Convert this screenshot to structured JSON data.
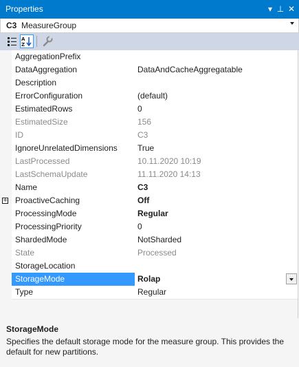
{
  "window": {
    "title": "Properties",
    "dropdown_glyph": "▾",
    "pin_glyph": "⊥",
    "close_glyph": "✕"
  },
  "object_selector": {
    "name": "C3",
    "type": "MeasureGroup"
  },
  "toolbar": {
    "categorized_icon": "categorized-icon",
    "alphabetical_icon": "alphabetical-icon",
    "property_pages_icon": "wrench-icon",
    "active": "alphabetical"
  },
  "properties": [
    {
      "name": "AggregationPrefix",
      "value": "",
      "readonly": false,
      "bold": false
    },
    {
      "name": "DataAggregation",
      "value": "DataAndCacheAggregatable",
      "readonly": false,
      "bold": false
    },
    {
      "name": "Description",
      "value": "",
      "readonly": false,
      "bold": false
    },
    {
      "name": "ErrorConfiguration",
      "value": "(default)",
      "readonly": false,
      "bold": false
    },
    {
      "name": "EstimatedRows",
      "value": "0",
      "readonly": false,
      "bold": false
    },
    {
      "name": "EstimatedSize",
      "value": "156",
      "readonly": true,
      "bold": false
    },
    {
      "name": "ID",
      "value": "C3",
      "readonly": true,
      "bold": false
    },
    {
      "name": "IgnoreUnrelatedDimensions",
      "value": "True",
      "readonly": false,
      "bold": false
    },
    {
      "name": "LastProcessed",
      "value": "10.11.2020 10:19",
      "readonly": true,
      "bold": false
    },
    {
      "name": "LastSchemaUpdate",
      "value": "11.11.2020 14:13",
      "readonly": true,
      "bold": false
    },
    {
      "name": "Name",
      "value": "C3",
      "readonly": false,
      "bold": true
    },
    {
      "name": "ProactiveCaching",
      "value": "Off",
      "readonly": false,
      "bold": true,
      "expandable": true
    },
    {
      "name": "ProcessingMode",
      "value": "Regular",
      "readonly": false,
      "bold": true
    },
    {
      "name": "ProcessingPriority",
      "value": "0",
      "readonly": false,
      "bold": false
    },
    {
      "name": "ShardedMode",
      "value": "NotSharded",
      "readonly": false,
      "bold": false
    },
    {
      "name": "State",
      "value": "Processed",
      "readonly": true,
      "bold": false
    },
    {
      "name": "StorageLocation",
      "value": "",
      "readonly": false,
      "bold": false
    },
    {
      "name": "StorageMode",
      "value": "Rolap",
      "readonly": false,
      "bold": true,
      "selected": true
    },
    {
      "name": "Type",
      "value": "Regular",
      "readonly": false,
      "bold": false
    }
  ],
  "description": {
    "title": "StorageMode",
    "text": "Specifies the default storage mode for the measure group. This provides the default for new partitions."
  },
  "colors": {
    "titlebar": "#007acc",
    "toolbar": "#cfd6e5",
    "selection": "#3399ff",
    "readonly_text": "#8a8a8a"
  }
}
